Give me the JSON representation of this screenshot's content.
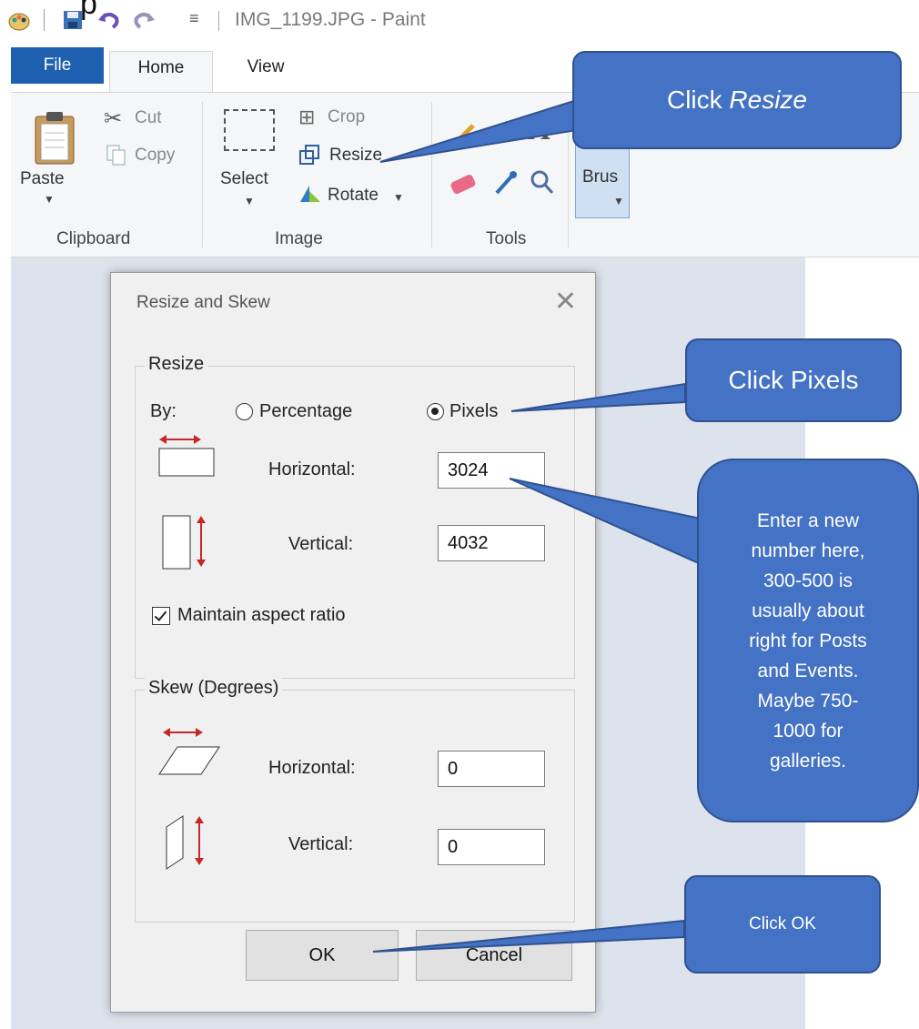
{
  "window": {
    "title": "IMG_1199.JPG - Paint",
    "clipped_caption": "p"
  },
  "ribbon": {
    "tabs": {
      "file": "File",
      "home": "Home",
      "view": "View"
    },
    "clipboard": {
      "paste": "Paste",
      "cut": "Cut",
      "copy": "Copy",
      "group_label": "Clipboard"
    },
    "image": {
      "select": "Select",
      "crop": "Crop",
      "resize": "Resize",
      "rotate": "Rotate",
      "group_label": "Image"
    },
    "tools": {
      "group_label": "Tools"
    },
    "brushes": {
      "label": "Brus"
    }
  },
  "dialog": {
    "title": "Resize and Skew",
    "resize_group": "Resize",
    "by_label": "By:",
    "percentage_option": "Percentage",
    "pixels_option": "Pixels",
    "selected_unit": "Pixels",
    "horizontal_label": "Horizontal:",
    "horizontal_value": "3024",
    "vertical_label": "Vertical:",
    "vertical_value": "4032",
    "maintain_aspect": "Maintain aspect ratio",
    "maintain_aspect_checked": true,
    "skew_group": "Skew (Degrees)",
    "skew_horizontal_label": "Horizontal:",
    "skew_horizontal_value": "0",
    "skew_vertical_label": "Vertical:",
    "skew_vertical_value": "0",
    "ok": "OK",
    "cancel": "Cancel"
  },
  "callouts": {
    "resize_prefix": "Click ",
    "resize_word": "Resize",
    "pixels": "Click Pixels",
    "enter": [
      "Enter a new",
      "number here,",
      "300-500 is",
      "usually about",
      "right for Posts",
      "and Events.",
      "Maybe 750-",
      "1000 for",
      "galleries."
    ],
    "ok": "Click OK"
  },
  "colors": {
    "callout": "#4472c4",
    "file_tab": "#1f5fb0",
    "arrow_icon": "#c62828"
  }
}
